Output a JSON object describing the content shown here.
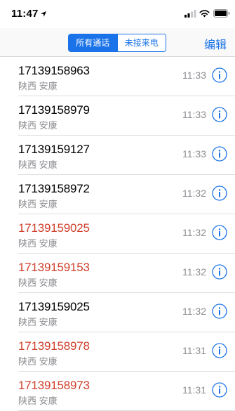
{
  "status_bar": {
    "time": "11:47"
  },
  "nav": {
    "segments": [
      "所有通话",
      "未接来电"
    ],
    "active_segment": "所有通话",
    "edit_label": "编辑"
  },
  "colors": {
    "accent": "#1a73e8",
    "missed": "#d0402d",
    "secondary_text": "#8e8e93"
  },
  "calls": [
    {
      "number": "17139158963",
      "location": "陕西 安康",
      "time": "11:33",
      "missed": false
    },
    {
      "number": "17139158979",
      "location": "陕西 安康",
      "time": "11:33",
      "missed": false
    },
    {
      "number": "17139159127",
      "location": "陕西 安康",
      "time": "11:33",
      "missed": false
    },
    {
      "number": "17139158972",
      "location": "陕西 安康",
      "time": "11:32",
      "missed": false
    },
    {
      "number": "17139159025",
      "location": "陕西 安康",
      "time": "11:32",
      "missed": true
    },
    {
      "number": "17139159153",
      "location": "陕西 安康",
      "time": "11:32",
      "missed": true
    },
    {
      "number": "17139159025",
      "location": "陕西 安康",
      "time": "11:32",
      "missed": false
    },
    {
      "number": "17139158978",
      "location": "陕西 安康",
      "time": "11:31",
      "missed": true
    },
    {
      "number": "17139158973",
      "location": "陕西 安康",
      "time": "11:31",
      "missed": true
    }
  ]
}
